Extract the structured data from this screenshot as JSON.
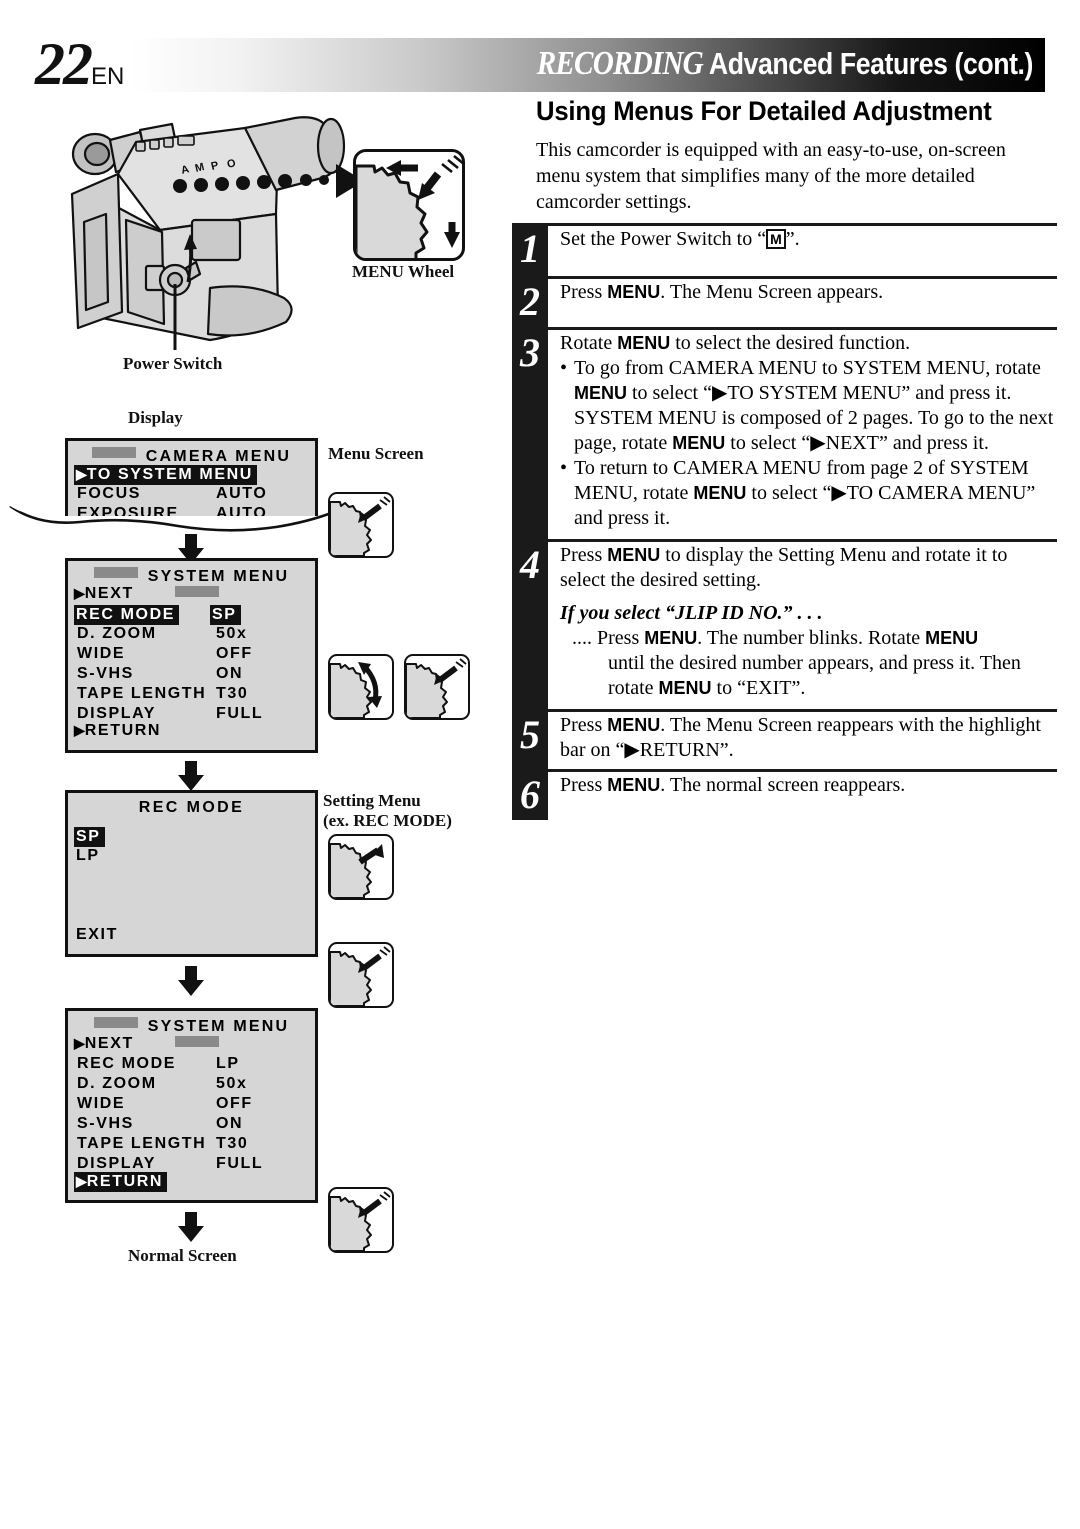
{
  "header": {
    "page_number": "22",
    "language": "EN",
    "title_italic": "RECORDING",
    "title_rest": "Advanced Features (cont.)"
  },
  "section": {
    "title": "Using Menus For Detailed Adjustment",
    "intro": "This camcorder is equipped with an easy-to-use, on-screen menu system that simplifies many of the more detailed camcorder settings."
  },
  "figure_labels": {
    "power_switch": "Power Switch",
    "menu_wheel": "MENU Wheel",
    "display": "Display",
    "menu_screen": "Menu Screen",
    "setting_menu_line1": "Setting Menu",
    "setting_menu_line2": "(ex. REC MODE)",
    "normal_screen": "Normal Screen"
  },
  "screens": {
    "camera_menu": {
      "title": "CAMERA  MENU",
      "rows": [
        {
          "label": "TO  SYSTEM  MENU",
          "value": "",
          "highlight": true,
          "arrow": true
        },
        {
          "label": "FOCUS",
          "value": "AUTO",
          "highlight": false,
          "arrow": false
        },
        {
          "label": "EXPOSURE",
          "value": "AUTO",
          "highlight": false,
          "arrow": false
        }
      ]
    },
    "system_menu_sp": {
      "title": "SYSTEM  MENU",
      "rows": [
        {
          "label": "NEXT",
          "value": "",
          "highlight": false,
          "arrow": true
        },
        {
          "label": "REC  MODE",
          "value": "SP",
          "highlight": true,
          "arrow": false
        },
        {
          "label": "D.  ZOOM",
          "value": "50x",
          "highlight": false,
          "arrow": false
        },
        {
          "label": "WIDE",
          "value": "OFF",
          "highlight": false,
          "arrow": false
        },
        {
          "label": "S-VHS",
          "value": "ON",
          "highlight": false,
          "arrow": false
        },
        {
          "label": "TAPE  LENGTH",
          "value": "T30",
          "highlight": false,
          "arrow": false
        },
        {
          "label": "DISPLAY",
          "value": "FULL",
          "highlight": false,
          "arrow": false
        }
      ],
      "footer": {
        "label": "RETURN",
        "highlight": false,
        "arrow": true
      }
    },
    "rec_mode": {
      "title": "REC  MODE",
      "options": [
        {
          "label": "SP",
          "highlight": true
        },
        {
          "label": "LP",
          "highlight": false
        }
      ],
      "footer": {
        "label": "EXIT"
      }
    },
    "system_menu_lp": {
      "title": "SYSTEM  MENU",
      "rows": [
        {
          "label": "NEXT",
          "value": "",
          "highlight": false,
          "arrow": true
        },
        {
          "label": "REC  MODE",
          "value": "LP",
          "highlight": false,
          "arrow": false
        },
        {
          "label": "D.  ZOOM",
          "value": "50x",
          "highlight": false,
          "arrow": false
        },
        {
          "label": "WIDE",
          "value": "OFF",
          "highlight": false,
          "arrow": false
        },
        {
          "label": "S-VHS",
          "value": "ON",
          "highlight": false,
          "arrow": false
        },
        {
          "label": "TAPE  LENGTH",
          "value": "T30",
          "highlight": false,
          "arrow": false
        },
        {
          "label": "DISPLAY",
          "value": "FULL",
          "highlight": false,
          "arrow": false
        }
      ],
      "footer": {
        "label": "RETURN",
        "highlight": true,
        "arrow": true
      }
    }
  },
  "steps": {
    "s1": {
      "num": "1",
      "text_before": "Set the Power Switch to “",
      "mbox": "M",
      "text_after": "”."
    },
    "s2": {
      "num": "2",
      "p1": "Press ",
      "b1": "MENU",
      "p2": ". The Menu Screen appears."
    },
    "s3": {
      "num": "3",
      "lead_a": "Rotate ",
      "lead_b": "MENU",
      "lead_c": " to select the desired function.",
      "b1_1": "To go from CAMERA MENU to SYSTEM MENU, rotate ",
      "b1_2": "MENU",
      "b1_3": " to select “▶TO SYSTEM MENU” and press it. SYSTEM MENU is composed of 2 pages. To go to the next page, rotate ",
      "b1_4": "MENU",
      "b1_5": " to select “▶NEXT” and press it.",
      "b2_1": "To return to CAMERA MENU from page 2 of SYSTEM MENU, rotate ",
      "b2_2": "MENU",
      "b2_3": " to select “▶TO CAMERA MENU” and press it."
    },
    "s4": {
      "num": "4",
      "p1": "Press ",
      "b1": "MENU",
      "p2": " to display the Setting Menu and rotate it to select the desired setting.",
      "subhead": "If you select “JLIP ID NO.” . . .",
      "sub1": ".... Press ",
      "subb1": "MENU",
      "sub2": ". The number blinks. Rotate ",
      "subb2": "MENU",
      "sub3": "until the desired number appears, and press it. Then rotate ",
      "subb3": "MENU",
      "sub4": " to “EXIT”."
    },
    "s5": {
      "num": "5",
      "p1": "Press ",
      "b1": "MENU",
      "p2": ". The Menu Screen reappears with the highlight bar on “▶RETURN”."
    },
    "s6": {
      "num": "6",
      "p1": "Press ",
      "b1": "MENU",
      "p2": ". The normal screen reappears."
    }
  },
  "colors": {
    "ink": "#111111",
    "screen_bg": "#d6d6d6",
    "highlight_bg": "#111111",
    "highlight_fg": "#ffffff",
    "title_block": "#8a8a8a"
  }
}
